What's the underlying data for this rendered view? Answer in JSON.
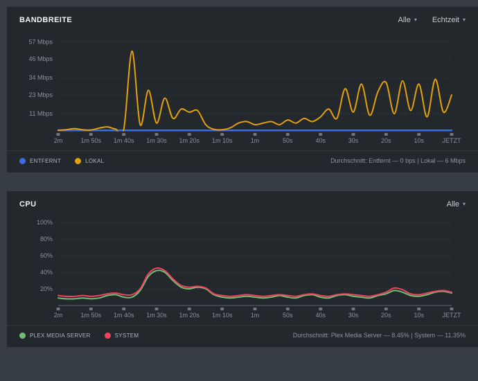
{
  "icons": {
    "chevron_down": "▾"
  },
  "colors": {
    "background": "#363c43",
    "panel": "#23282d",
    "remote": "#3d6be0",
    "local": "#e5a00d",
    "plex": "#72bd75",
    "system": "#f0435f"
  },
  "panels": [
    {
      "title": "BANDBREITE",
      "dropdowns": [
        "Alle",
        "Echtzeit"
      ],
      "legend": [
        {
          "label": "ENTFERNT",
          "color": "#3d6be0"
        },
        {
          "label": "LOKAL",
          "color": "#e5a00d"
        }
      ],
      "footer": "Durchschnitt: Entfernt — 0 bps | Lokal — 6 Mbps"
    },
    {
      "title": "CPU",
      "dropdowns": [
        "Alle"
      ],
      "legend": [
        {
          "label": "PLEX MEDIA SERVER",
          "color": "#72bd75"
        },
        {
          "label": "SYSTEM",
          "color": "#f0435f"
        }
      ],
      "footer": "Durchschnitt: Plex Media Server — 8.45% | System — 11.35%"
    }
  ],
  "chart_data": [
    {
      "type": "line",
      "title": "BANDBREITE",
      "ylim": [
        0,
        62
      ],
      "y_ticks": [
        {
          "value": 11,
          "label": "11 Mbps"
        },
        {
          "value": 23,
          "label": "23 Mbps"
        },
        {
          "value": 34,
          "label": "34 Mbps"
        },
        {
          "value": 46,
          "label": "46 Mbps"
        },
        {
          "value": 57,
          "label": "57 Mbps"
        }
      ],
      "x_ticks": [
        "2m",
        "1m 50s",
        "1m 40s",
        "1m 30s",
        "1m 20s",
        "1m 10s",
        "1m",
        "50s",
        "40s",
        "30s",
        "20s",
        "10s",
        "JETZT"
      ],
      "legend_position": "bottom-left",
      "grid": true,
      "series": [
        {
          "name": "ENTFERNT",
          "color": "#3d6be0",
          "stroke_width": 2.4,
          "values": [
            0.4,
            0.4,
            0.4,
            0.4,
            0.4,
            0.4,
            0.4,
            0.4,
            0.4,
            0.4,
            0.4,
            0.4,
            0.4,
            0.4,
            0.4,
            0.4,
            0.4,
            0.4,
            0.4,
            0.4,
            0.4,
            0.4,
            0.4,
            0.4,
            0.4,
            0.4,
            0.4,
            0.4,
            0.4,
            0.4,
            0.4,
            0.4,
            0.4,
            0.4,
            0.4,
            0.4,
            0.4,
            0.4,
            0.4,
            0.4,
            0.4,
            0.4,
            0.4,
            0.4,
            0.4,
            0.4,
            0.4,
            0.4,
            0.4
          ]
        },
        {
          "name": "LOKAL",
          "color": "#e5a00d",
          "stroke_width": 2,
          "values": [
            0.4,
            0.8,
            1.5,
            0.7,
            0.6,
            1.8,
            2.6,
            1.2,
            1.0,
            51,
            4,
            26,
            5,
            21,
            8,
            14,
            12,
            13,
            4,
            1,
            0.8,
            2,
            5,
            6,
            4,
            5,
            6,
            4,
            7,
            5,
            8,
            6,
            9,
            14,
            8,
            27,
            12,
            30,
            10,
            25,
            31,
            11,
            32,
            13,
            30,
            9,
            33,
            12,
            23
          ]
        }
      ]
    },
    {
      "type": "line",
      "title": "CPU",
      "ylim": [
        0,
        105
      ],
      "y_ticks": [
        {
          "value": 20,
          "label": "20%"
        },
        {
          "value": 40,
          "label": "40%"
        },
        {
          "value": 60,
          "label": "60%"
        },
        {
          "value": 80,
          "label": "80%"
        },
        {
          "value": 100,
          "label": "100%"
        }
      ],
      "x_ticks": [
        "2m",
        "1m 50s",
        "1m 40s",
        "1m 30s",
        "1m 20s",
        "1m 10s",
        "1m",
        "50s",
        "40s",
        "30s",
        "20s",
        "10s",
        "JETZT"
      ],
      "legend_position": "bottom-left",
      "grid": true,
      "series": [
        {
          "name": "PLEX MEDIA SERVER",
          "color": "#72bd75",
          "stroke_width": 2,
          "values": [
            9,
            8,
            8,
            9,
            8,
            9,
            12,
            13,
            10,
            10,
            18,
            35,
            42,
            40,
            30,
            22,
            20,
            22,
            20,
            13,
            10,
            9,
            10,
            11,
            10,
            9,
            10,
            12,
            10,
            9,
            12,
            13,
            10,
            9,
            12,
            13,
            11,
            10,
            9,
            12,
            14,
            18,
            16,
            12,
            11,
            13,
            16,
            17,
            15
          ]
        },
        {
          "name": "SYSTEM",
          "color": "#f0435f",
          "stroke_width": 2,
          "values": [
            12,
            11,
            11,
            12,
            11,
            12,
            14,
            15,
            13,
            13,
            20,
            38,
            45,
            42,
            32,
            24,
            22,
            23,
            21,
            14,
            12,
            11,
            12,
            13,
            12,
            11,
            12,
            13,
            12,
            11,
            13,
            14,
            12,
            11,
            13,
            14,
            13,
            12,
            11,
            13,
            16,
            21,
            19,
            14,
            13,
            15,
            17,
            18,
            16
          ]
        }
      ]
    }
  ]
}
